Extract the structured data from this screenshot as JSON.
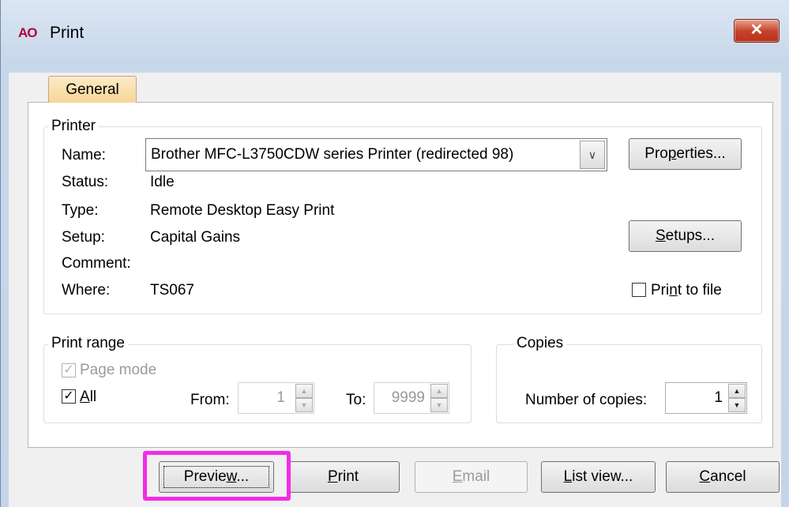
{
  "window": {
    "app_icon_text": "AO",
    "title": "Print",
    "close_glyph": "✕"
  },
  "tabs": [
    {
      "label": "General",
      "active": true
    }
  ],
  "printer": {
    "group_label": "Printer",
    "name_label": "Name:",
    "name_value": "Brother MFC-L3750CDW series Printer (redirected 98)",
    "status_label": "Status:",
    "status_value": "Idle",
    "type_label": "Type:",
    "type_value": "Remote Desktop Easy Print",
    "setup_label": "Setup:",
    "setup_value": "Capital Gains",
    "comment_label": "Comment:",
    "comment_value": "",
    "where_label": "Where:",
    "where_value": "TS067",
    "properties_button": {
      "pre": "Pro",
      "accel": "p",
      "post": "erties..."
    },
    "setups_button": {
      "pre": "",
      "accel": "S",
      "post": "etups..."
    },
    "print_to_file": {
      "pre": "Pri",
      "accel": "n",
      "post": "t to file",
      "checked": false
    }
  },
  "print_range": {
    "group_label": "Print range",
    "page_mode": {
      "label": "Page mode",
      "checked": true,
      "enabled": false
    },
    "all": {
      "accel": "A",
      "post": "ll",
      "checked": true
    },
    "from_label": "From:",
    "from_value": "1",
    "to_label": "To:",
    "to_value": "9999"
  },
  "copies": {
    "group_label": "Copies",
    "number_label": "Number of copies:",
    "number_value": "1"
  },
  "buttons": {
    "preview": {
      "pre": "Previe",
      "accel": "w",
      "post": "..."
    },
    "print": {
      "pre": "",
      "accel": "P",
      "post": "rint"
    },
    "email": {
      "pre": "",
      "accel": "E",
      "post": "mail"
    },
    "list_view": {
      "pre": "",
      "accel": "L",
      "post": "ist view..."
    },
    "cancel": {
      "pre": "",
      "accel": "C",
      "post": "ancel"
    }
  },
  "colors": {
    "highlight": "#f22ce6",
    "tab_active": "#f7d596",
    "close_button": "#c6452c",
    "app_icon": "#b1003b"
  },
  "icons": {
    "combo_dropdown": "chevron-down-icon",
    "spin_up": "arrow-up-icon",
    "spin_down": "arrow-down-icon",
    "check": "checkmark-icon"
  }
}
